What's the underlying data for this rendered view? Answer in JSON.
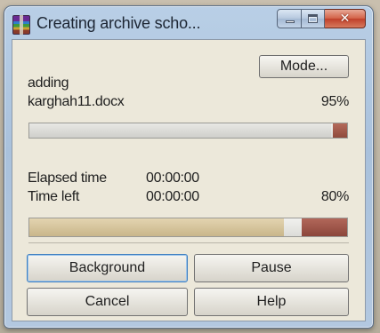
{
  "window": {
    "title": "Creating archive scho..."
  },
  "progress_top": {
    "status_label": "adding",
    "file_name": "karghah11.docx",
    "percent_text": "95%",
    "percent_value": 95
  },
  "progress_bottom": {
    "elapsed_label": "Elapsed time",
    "elapsed_value": "00:00:00",
    "left_label": "Time left",
    "left_value": "00:00:00",
    "percent_text": "80%",
    "percent_value": 80
  },
  "buttons": {
    "mode": "Mode...",
    "background": "Background",
    "pause": "Pause",
    "cancel": "Cancel",
    "help": "Help"
  },
  "icons": [
    "winrar-archive-icon",
    "minimize-icon",
    "maximize-icon",
    "close-icon"
  ]
}
